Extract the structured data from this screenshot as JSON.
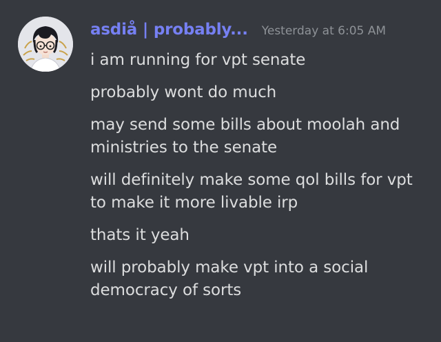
{
  "message": {
    "author": {
      "username": "asdiå | probably...",
      "avatar_icon": "user-avatar-illustration",
      "username_color": "#7680f3"
    },
    "timestamp": "Yesterday at 6:05 AM",
    "lines": [
      "i am running for vpt senate",
      "probably wont do much",
      "may send some bills about moolah and ministries to the senate",
      "will definitely make some qol bills for vpt to make it more livable irp",
      "thats it yeah",
      "will probably make vpt into a social democracy of sorts"
    ]
  },
  "theme": {
    "background": "#36393f",
    "text": "#dcddde",
    "timestamp": "#8e9297"
  }
}
